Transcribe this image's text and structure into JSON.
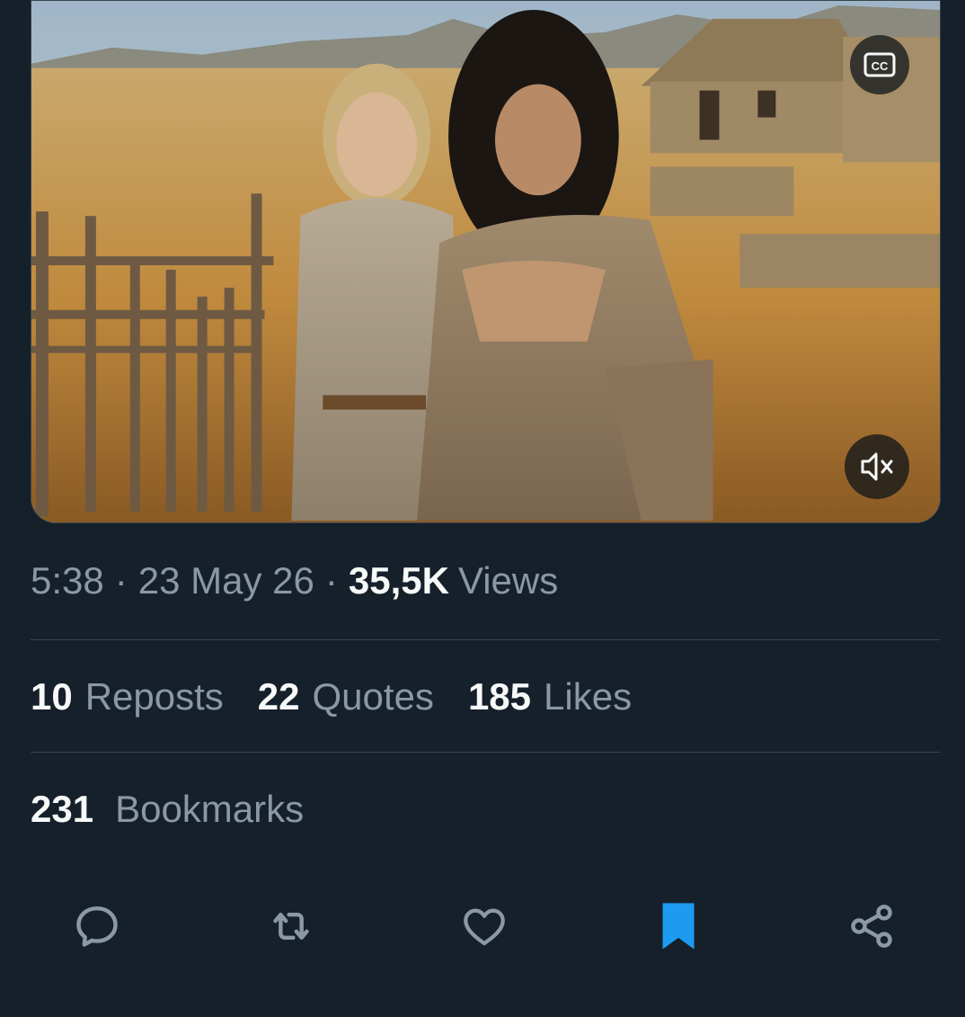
{
  "media": {
    "cc_label": "CC",
    "cc_icon": "closed-captions-icon",
    "mute_icon": "speaker-muted-icon"
  },
  "meta": {
    "time": "5:38",
    "separator": "·",
    "date": "23 May 26",
    "views_count": "35,5K",
    "views_label": "Views"
  },
  "stats": {
    "reposts_count": "10",
    "reposts_label": "Reposts",
    "quotes_count": "22",
    "quotes_label": "Quotes",
    "likes_count": "185",
    "likes_label": "Likes",
    "bookmarks_count": "231",
    "bookmarks_label": "Bookmarks"
  },
  "actions": [
    {
      "name": "reply",
      "icon": "reply-icon"
    },
    {
      "name": "repost",
      "icon": "repost-icon"
    },
    {
      "name": "like",
      "icon": "heart-icon"
    },
    {
      "name": "bookmark",
      "icon": "bookmark-icon",
      "active": true
    },
    {
      "name": "share",
      "icon": "share-icon"
    }
  ],
  "colors": {
    "background": "#15202b",
    "text_primary": "#f7f9f9",
    "text_secondary": "#8b98a5",
    "accent": "#1d9bf0",
    "divider": "#38444d"
  }
}
